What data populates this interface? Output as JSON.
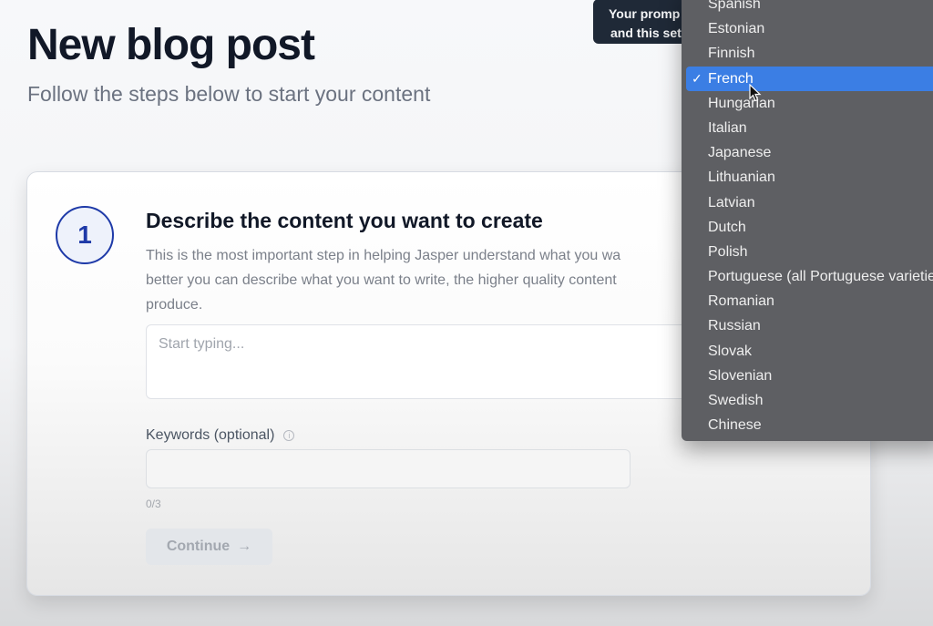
{
  "header": {
    "title": "New blog post",
    "subtitle": "Follow the steps below to start your content"
  },
  "step": {
    "number": "1",
    "title": "Describe the content you want to create",
    "description": "This is the most important step in helping Jasper understand what you want. The better you can describe what you want to write, the higher quality content Jasper can produce.",
    "description_visible_lines": [
      "This is the most important step in helping Jasper understand what you wa",
      "better you can describe what you want to write, the higher quality content",
      "produce."
    ],
    "content_input": {
      "placeholder": "Start typing...",
      "value": ""
    },
    "keywords": {
      "label": "Keywords (optional)",
      "info_icon": "info-icon",
      "value": "",
      "count": "0/3"
    },
    "continue_button": {
      "label": "Continue",
      "icon": "arrow-right-icon",
      "arrow_glyph": "→",
      "disabled": true
    }
  },
  "tooltip": {
    "lines": [
      "Your promp",
      "and this set"
    ]
  },
  "language_dropdown": {
    "selected": "French",
    "check_glyph": "✓",
    "options": [
      "Spanish",
      "Estonian",
      "Finnish",
      "French",
      "Hungarian",
      "Italian",
      "Japanese",
      "Lithuanian",
      "Latvian",
      "Dutch",
      "Polish",
      "Portuguese (all Portuguese varieties)",
      "Romanian",
      "Russian",
      "Slovak",
      "Slovenian",
      "Swedish",
      "Chinese"
    ]
  },
  "colors": {
    "accent_blue": "#3b7ee4",
    "step_circle": "#1e3aa8",
    "dropdown_bg": "#5e5f63",
    "tooltip_bg": "#1f2937"
  }
}
